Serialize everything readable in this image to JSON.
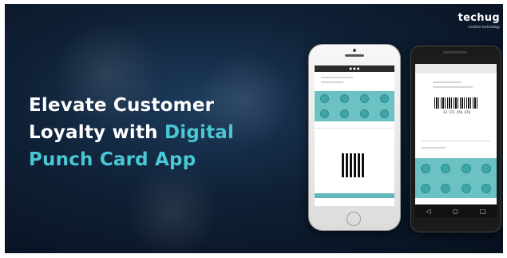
{
  "headline": {
    "line1": "Elevate Customer",
    "line2_plain": "Loyalty with ",
    "line2_accent": "Digital",
    "line3": "Punch Card App"
  },
  "logo": {
    "name": "techug",
    "tagline": "creative technology"
  },
  "colors": {
    "accent": "#49c7d3",
    "background": "#0f2036",
    "stamp_panel": "#6cc2c2"
  },
  "iphone": {
    "status": "● ● ●",
    "stamps_count": 8
  },
  "android": {
    "barcode_number": "23 573 456 670",
    "stamps_count": 8
  }
}
